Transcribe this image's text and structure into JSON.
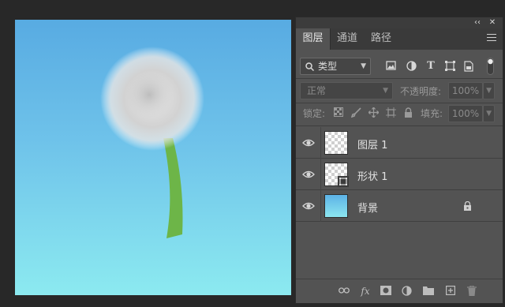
{
  "panel": {
    "collapse_icon": "‹‹",
    "close_icon": "✕",
    "tabs": [
      {
        "label": "图层",
        "active": true
      },
      {
        "label": "通道",
        "active": false
      },
      {
        "label": "路径",
        "active": false
      }
    ]
  },
  "filter": {
    "kind_label": "类型"
  },
  "blend": {
    "mode": "正常",
    "opacity_label": "不透明度:",
    "opacity_value": "100%"
  },
  "lock_row": {
    "lock_label": "锁定:",
    "fill_label": "填充:",
    "fill_value": "100%"
  },
  "layers": [
    {
      "name": "图层 1",
      "type": "pixel",
      "visible": true
    },
    {
      "name": "形状 1",
      "type": "shape",
      "visible": true
    },
    {
      "name": "背景",
      "type": "background",
      "visible": true,
      "locked": true
    }
  ],
  "colors": {
    "sky_top": "#58abe2",
    "sky_bottom": "#8ceaf0",
    "stem": "#6db548"
  }
}
